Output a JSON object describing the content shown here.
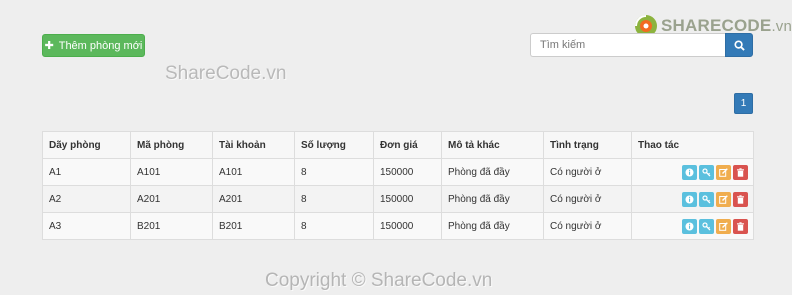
{
  "toolbar": {
    "add_room_label": "Thêm phòng mới"
  },
  "search": {
    "placeholder": "Tìm kiếm"
  },
  "logo": {
    "brand": "SHARECODE",
    "suffix": ".vn"
  },
  "watermark": {
    "text": "ShareCode.vn"
  },
  "footer": {
    "copyright": "Copyright © ShareCode.vn"
  },
  "pagination": {
    "current_page": "1"
  },
  "table": {
    "headers": [
      "Dãy phòng",
      "Mã phòng",
      "Tài khoản",
      "Số lượng",
      "Đơn giá",
      "Mô tả khác",
      "Tình trạng",
      "Thao tác"
    ],
    "rows": [
      [
        "A1",
        "A101",
        "A101",
        "8",
        "150000",
        "Phòng đã đầy",
        "Có người ở"
      ],
      [
        "A2",
        "A201",
        "A201",
        "8",
        "150000",
        "Phòng đã đầy",
        "Có người ở"
      ],
      [
        "A3",
        "B201",
        "B201",
        "8",
        "150000",
        "Phòng đã đầy",
        "Có người ở"
      ]
    ],
    "row_actions": [
      "info-icon",
      "key-icon",
      "edit-icon",
      "trash-icon"
    ]
  },
  "colors": {
    "add_button": "#5cb85c",
    "primary": "#337ab7",
    "info": "#5bc0de",
    "warning": "#f0ad4e",
    "danger": "#d9534f"
  }
}
